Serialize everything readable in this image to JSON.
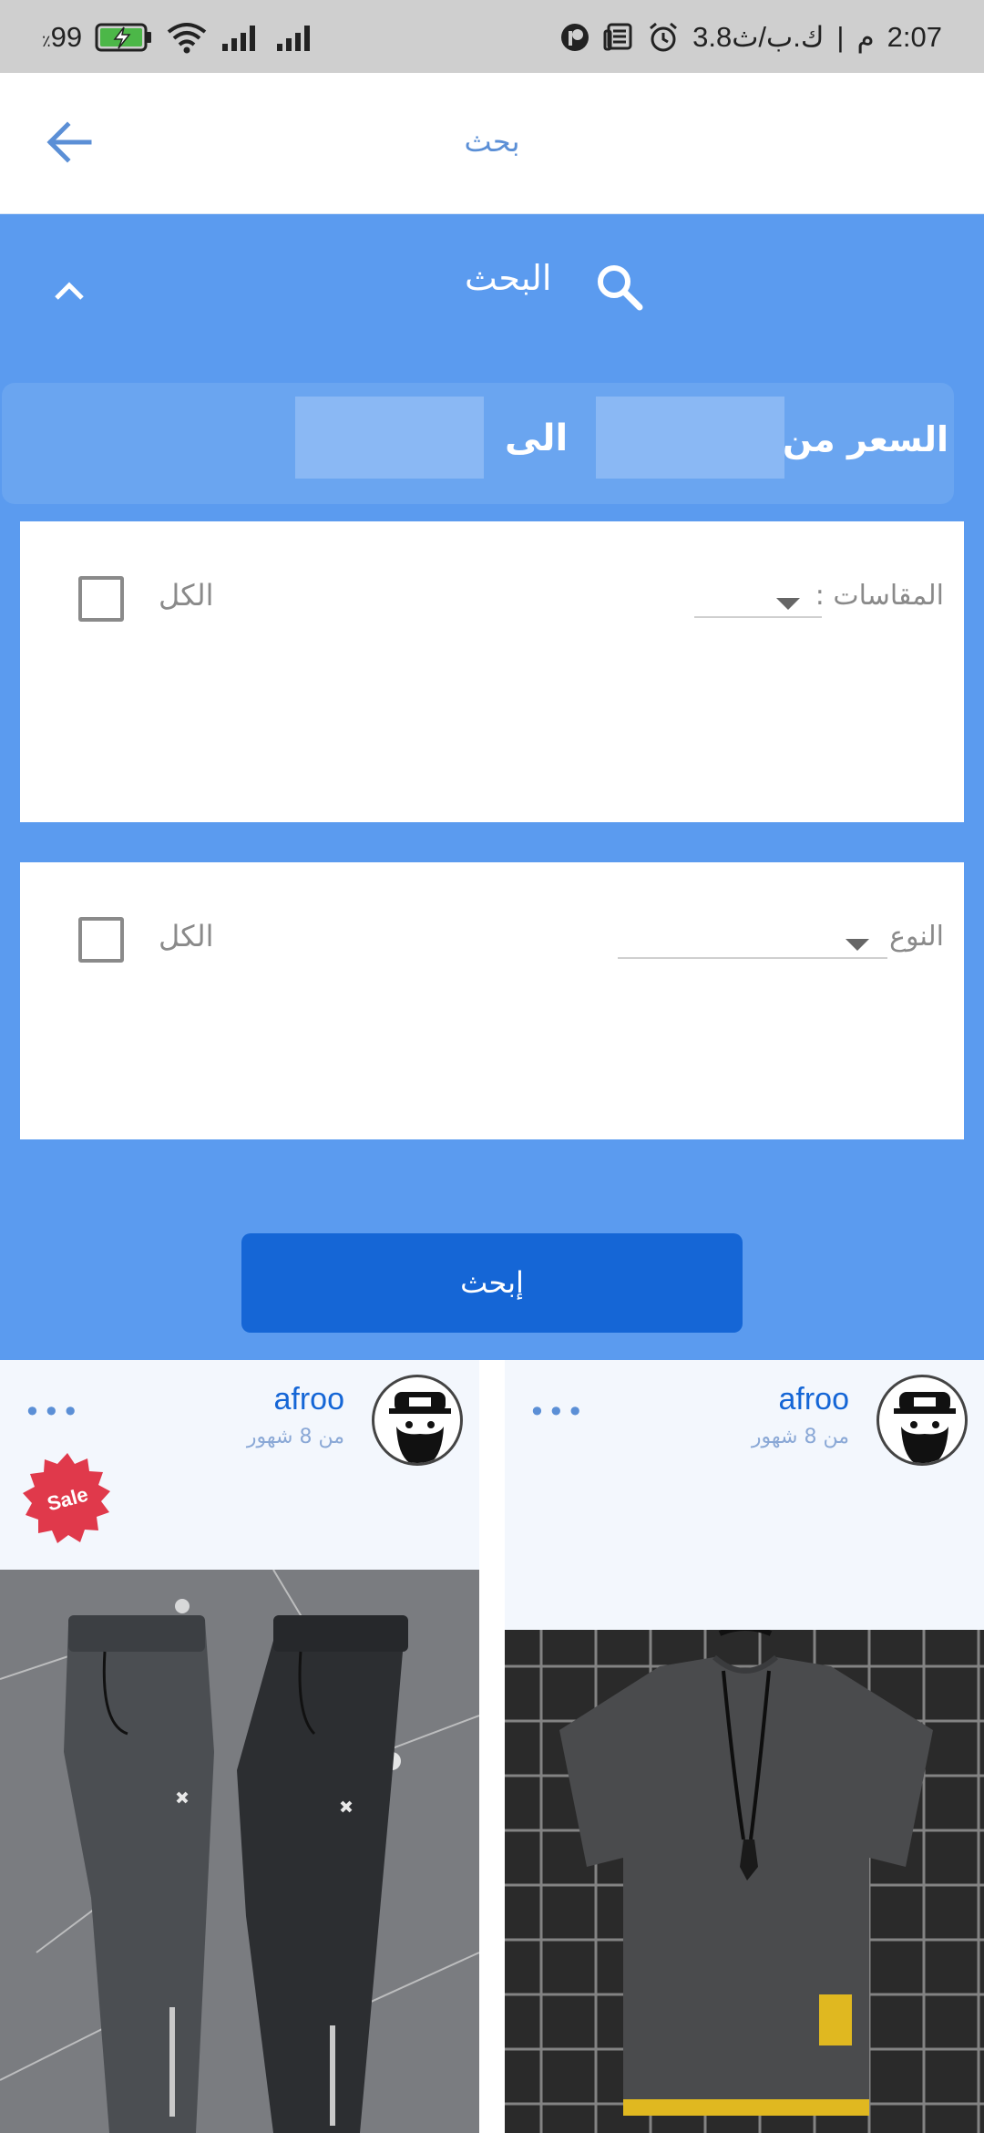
{
  "status_bar": {
    "time": "2:07",
    "period": "م",
    "network_speed": "3.8ك.ب/ث",
    "battery": "99",
    "battery_unit": "٪",
    "icons": [
      "alarm-icon",
      "news-icon",
      "app-icon",
      "signal-icon",
      "signal-icon",
      "wifi-icon",
      "battery-charging-icon"
    ]
  },
  "appbar": {
    "title": "بحث",
    "back_icon": "arrow-left-icon"
  },
  "search_panel": {
    "title": "البحث",
    "collapse_icon": "chevron-up-icon",
    "search_icon": "search-icon",
    "price": {
      "label": "السعر من",
      "to_label": "الى",
      "from_value": "",
      "to_value": ""
    },
    "sizes": {
      "label": "المقاسات :",
      "all_label": "الكل",
      "all_checked": false
    },
    "type": {
      "label": "النوع",
      "all_label": "الكل",
      "all_checked": false
    },
    "search_button": "إبحث"
  },
  "products": [
    {
      "seller": "afroo",
      "time": "من 8 شهور",
      "badge": "Sale",
      "image": "grey-and-black-joggers",
      "more_icon": "more-dots-icon"
    },
    {
      "seller": "afroo",
      "time": "من 8 شهور",
      "badge": "",
      "image": "grey-tshirt",
      "more_icon": "more-dots-icon"
    }
  ],
  "colors": {
    "panel_blue": "#5b9bef",
    "button_blue": "#1566d6",
    "link_blue": "#5b8fd6",
    "sale_red": "#e0394b"
  }
}
